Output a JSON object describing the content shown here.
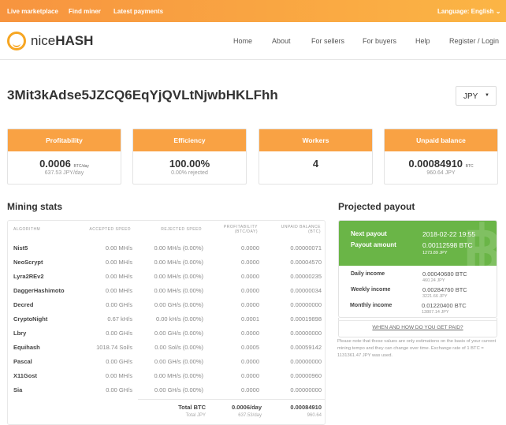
{
  "topbar": {
    "links": [
      "Live marketplace",
      "Find miner",
      "Latest payments"
    ],
    "language": "Language: English"
  },
  "logo": {
    "text_light": "nice",
    "text_bold": "HASH"
  },
  "nav": [
    "Home",
    "About",
    "For sellers",
    "For buyers",
    "Help",
    "Register / Login"
  ],
  "address": "3Mit3kAdse5JZCQ6EqYjQVLtNjwbHKLFhh",
  "currency": "JPY",
  "cards": [
    {
      "title": "Profitability",
      "value": "0.0006",
      "unit": "BTC/day",
      "sub": "637.53 JPY/day"
    },
    {
      "title": "Efficiency",
      "value": "100.00%",
      "unit": "",
      "sub": "0.00% rejected"
    },
    {
      "title": "Workers",
      "value": "4",
      "unit": "",
      "sub": ""
    },
    {
      "title": "Unpaid balance",
      "value": "0.00084910",
      "unit": "BTC",
      "sub": "960.64 JPY"
    }
  ],
  "mining": {
    "title": "Mining stats",
    "headers": [
      "ALGORITHM",
      "ACCEPTED SPEED",
      "REJECTED SPEED",
      "PROFITABILITY (BTC/DAY)",
      "UNPAID BALANCE (BTC)"
    ],
    "rows": [
      [
        "Nist5",
        "0.00 MH/s",
        "0.00 MH/s (0.00%)",
        "0.0000",
        "0.00000071"
      ],
      [
        "NeoScrypt",
        "0.00 MH/s",
        "0.00 MH/s (0.00%)",
        "0.0000",
        "0.00004570"
      ],
      [
        "Lyra2REv2",
        "0.00 MH/s",
        "0.00 MH/s (0.00%)",
        "0.0000",
        "0.00000235"
      ],
      [
        "DaggerHashimoto",
        "0.00 MH/s",
        "0.00 MH/s (0.00%)",
        "0.0000",
        "0.00000034"
      ],
      [
        "Decred",
        "0.00 GH/s",
        "0.00 GH/s (0.00%)",
        "0.0000",
        "0.00000000"
      ],
      [
        "CryptoNight",
        "0.67 kH/s",
        "0.00 kH/s (0.00%)",
        "0.0001",
        "0.00019898"
      ],
      [
        "Lbry",
        "0.00 GH/s",
        "0.00 GH/s (0.00%)",
        "0.0000",
        "0.00000000"
      ],
      [
        "Equihash",
        "1018.74 Sol/s",
        "0.00 Sol/s (0.00%)",
        "0.0005",
        "0.00059142"
      ],
      [
        "Pascal",
        "0.00 GH/s",
        "0.00 GH/s (0.00%)",
        "0.0000",
        "0.00000000"
      ],
      [
        "X11Gost",
        "0.00 MH/s",
        "0.00 MH/s (0.00%)",
        "0.0000",
        "0.00000960"
      ],
      [
        "Sia",
        "0.00 GH/s",
        "0.00 GH/s (0.00%)",
        "0.0000",
        "0.00000000"
      ]
    ],
    "total_btc": {
      "label": "Total BTC",
      "profit": "0.0006/day",
      "balance": "0.00084910"
    },
    "total_jpy": {
      "label": "Total JPY",
      "profit": "637.53/day",
      "balance": "960.64"
    }
  },
  "payout": {
    "title": "Projected payout",
    "next_label": "Next payout",
    "next_value": "2018-02-22 19:55",
    "amount_label": "Payout amount",
    "amount_value": "0.00112598 BTC",
    "amount_jpy": "1273.89 JPY",
    "income": [
      {
        "label": "Daily income",
        "btc": "0.00040680 BTC",
        "jpy": "460.24 JPY"
      },
      {
        "label": "Weekly income",
        "btc": "0.00284760 BTC",
        "jpy": "3221.66 JPY"
      },
      {
        "label": "Monthly income",
        "btc": "0.01220400 BTC",
        "jpy": "13807.14 JPY"
      }
    ],
    "link": "WHEN AND HOW DO YOU GET PAID?",
    "note": "Please note that these values are only estimations on the basis of your current mining tempo and they can change over time. Exchange rate of 1 BTC = 1131361.47 JPY was used."
  },
  "colors": {
    "orange": "#f9a244",
    "green": "#6ab547"
  }
}
